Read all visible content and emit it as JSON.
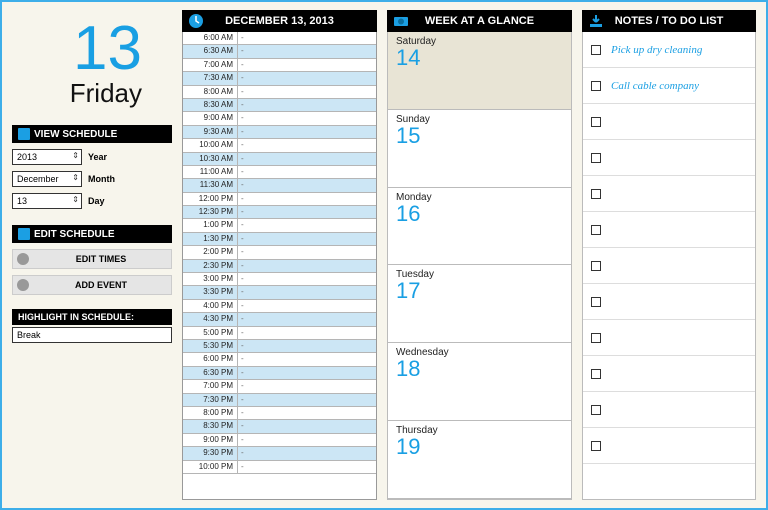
{
  "date": {
    "big_number": "13",
    "weekday": "Friday",
    "full": "DECEMBER 13, 2013"
  },
  "view_schedule": {
    "title": "VIEW SCHEDULE",
    "year": {
      "value": "2013",
      "label": "Year"
    },
    "month": {
      "value": "December",
      "label": "Month"
    },
    "day": {
      "value": "13",
      "label": "Day"
    }
  },
  "edit_schedule": {
    "title": "EDIT SCHEDULE",
    "edit_times": "EDIT TIMES",
    "add_event": "ADD EVENT"
  },
  "highlight": {
    "title": "HIGHLIGHT IN SCHEDULE:",
    "value": "Break"
  },
  "schedule": {
    "times": [
      "6:00 AM",
      "6:30 AM",
      "7:00 AM",
      "7:30 AM",
      "8:00 AM",
      "8:30 AM",
      "9:00 AM",
      "9:30 AM",
      "10:00 AM",
      "10:30 AM",
      "11:00 AM",
      "11:30 AM",
      "12:00 PM",
      "12:30 PM",
      "1:00 PM",
      "1:30 PM",
      "2:00 PM",
      "2:30 PM",
      "3:00 PM",
      "3:30 PM",
      "4:00 PM",
      "4:30 PM",
      "5:00 PM",
      "5:30 PM",
      "6:00 PM",
      "6:30 PM",
      "7:00 PM",
      "7:30 PM",
      "8:00 PM",
      "8:30 PM",
      "9:00 PM",
      "9:30 PM",
      "10:00 PM"
    ],
    "dash": "-"
  },
  "week": {
    "title": "WEEK AT A GLANCE",
    "days": [
      {
        "name": "Saturday",
        "num": "14"
      },
      {
        "name": "Sunday",
        "num": "15"
      },
      {
        "name": "Monday",
        "num": "16"
      },
      {
        "name": "Tuesday",
        "num": "17"
      },
      {
        "name": "Wednesday",
        "num": "18"
      },
      {
        "name": "Thursday",
        "num": "19"
      }
    ]
  },
  "notes": {
    "title": "NOTES / TO DO LIST",
    "items": [
      "Pick up dry cleaning",
      "Call cable company",
      "",
      "",
      "",
      "",
      "",
      "",
      "",
      "",
      "",
      ""
    ]
  }
}
